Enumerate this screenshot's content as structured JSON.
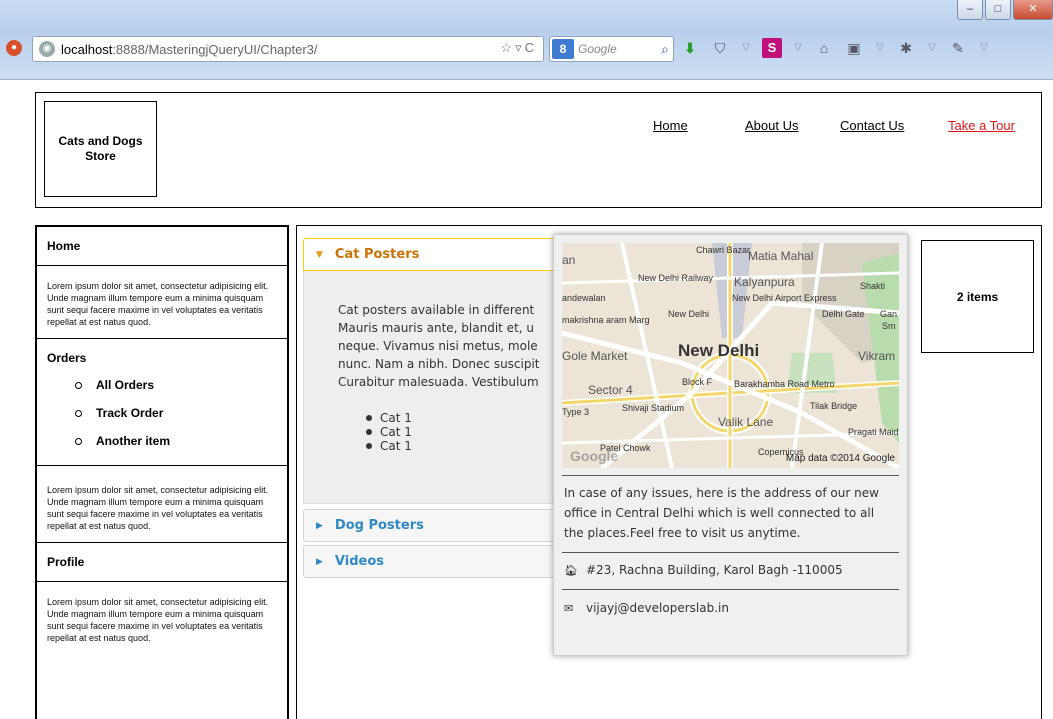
{
  "browser": {
    "url_host": "localhost",
    "url_path": ":8888/MasteringjQueryUI/Chapter3/",
    "search_placeholder": "Google",
    "minimize": "–",
    "maximize": "□",
    "close": "✕"
  },
  "header": {
    "logo": "Cats and Dogs Store",
    "nav": [
      "Home",
      "About Us",
      "Contact Us",
      "Take a Tour"
    ]
  },
  "sidebar": {
    "home": "Home",
    "lorem": "Lorem ipsum dolor sit amet, consectetur adipisicing elit. Unde magnam illum tempore eum a minima quisquam sunt sequi facere maxime in vel voluptates ea veritatis repellat at est natus quod.",
    "orders_title": "Orders",
    "orders": [
      "All Orders",
      "Track Order",
      "Another item"
    ],
    "profile": "Profile"
  },
  "accordion": {
    "sections": [
      "Cat Posters",
      "Dog Posters",
      "Videos"
    ],
    "panel_text": "Cat posters available in different\nMauris mauris ante, blandit et, u\nneque. Vivamus nisi metus, mole\nnunc. Nam a nibh. Donec suscipit\nCurabitur malesuada. Vestibulum",
    "panel_items": [
      "Cat 1",
      "Cat 1",
      "Cat 1"
    ]
  },
  "cart": "2 items",
  "popup": {
    "map_labels": {
      "chawri_bazar": "Chawri Bazar",
      "matia_mahal": "Matia Mahal",
      "new_delhi_railway": "New Delhi Railway",
      "kalyanpura": "Kalyanpura",
      "shakti": "Shakti",
      "jhandewalan": "andewalan",
      "new_delhi_airport": "New Delhi Airport Express",
      "delhi_gate": "Delhi Gate",
      "new_delhi_station": "New Delhi",
      "ramakrishna": "makrishna aram Marg",
      "new_delhi": "New Delhi",
      "gole_market": "Gole Market",
      "vikram_nagar": "Vikram Nagar",
      "block_f": "Block F",
      "barakhamba": "Barakhamba Road Metro",
      "sector4": "Sector 4",
      "type3": "Type 3",
      "shivaji": "Shivaji Stadium",
      "valik_lane": "Valik Lane",
      "tilak_bridge": "Tilak Bridge",
      "patel_chowk": "Patel Chowk",
      "copernicus": "Copernicus",
      "pragati_maidan": "Pragati Maidan",
      "gan": "Gan",
      "sm": "Sm",
      "an": "an"
    },
    "map_credit": "Map data ©2014 Google",
    "map_logo": "Google",
    "info": "In case of any issues, here is the address of our new office in Central Delhi which is well connected to all the places.Feel free to visit us anytime.",
    "address": "#23, Rachna Building, Karol Bagh -110005",
    "email": "vijayj@developerslab.in"
  }
}
